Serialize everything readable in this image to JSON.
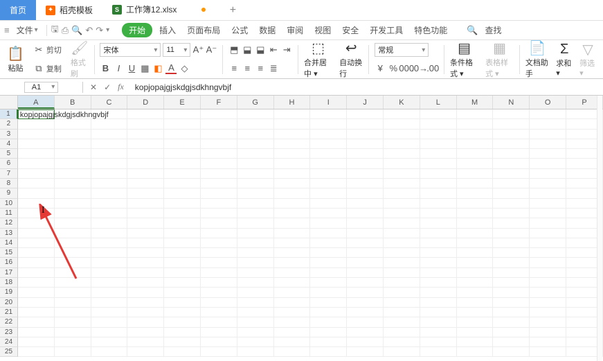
{
  "titlebar": {
    "home": "首页",
    "template": "稻壳模板",
    "workbook": "工作簿12.xlsx"
  },
  "menubar": {
    "file": "文件",
    "start": "开始",
    "insert": "插入",
    "pageLayout": "页面布局",
    "formula": "公式",
    "data": "数据",
    "review": "审阅",
    "view": "视图",
    "security": "安全",
    "devtools": "开发工具",
    "special": "特色功能",
    "search": "查找"
  },
  "ribbon": {
    "paste": "粘贴",
    "cut": "剪切",
    "copy": "复制",
    "formatPainter": "格式刷",
    "fontName": "宋体",
    "fontSize": "11",
    "mergeCenter": "合并居中",
    "wrapText": "自动换行",
    "numberFormat": "常规",
    "condFormat": "条件格式",
    "cellStyle": "表格样式",
    "docAssist": "文档助手",
    "sum": "求和",
    "filter": "筛选"
  },
  "fxbar": {
    "nameBox": "A1",
    "formula": "kopjopajgjskdgjsdkhngvbjf"
  },
  "grid": {
    "columns": [
      "A",
      "B",
      "C",
      "D",
      "E",
      "F",
      "G",
      "H",
      "I",
      "J",
      "K",
      "L",
      "M",
      "N",
      "O",
      "P"
    ],
    "rows": [
      "1",
      "2",
      "3",
      "4",
      "5",
      "6",
      "7",
      "8",
      "9",
      "10",
      "11",
      "12",
      "13",
      "14",
      "15",
      "16",
      "17",
      "18",
      "19",
      "20",
      "21",
      "22",
      "23",
      "24",
      "25"
    ],
    "a1": "kopjopajgjskdgjsdkhngvbjf"
  }
}
